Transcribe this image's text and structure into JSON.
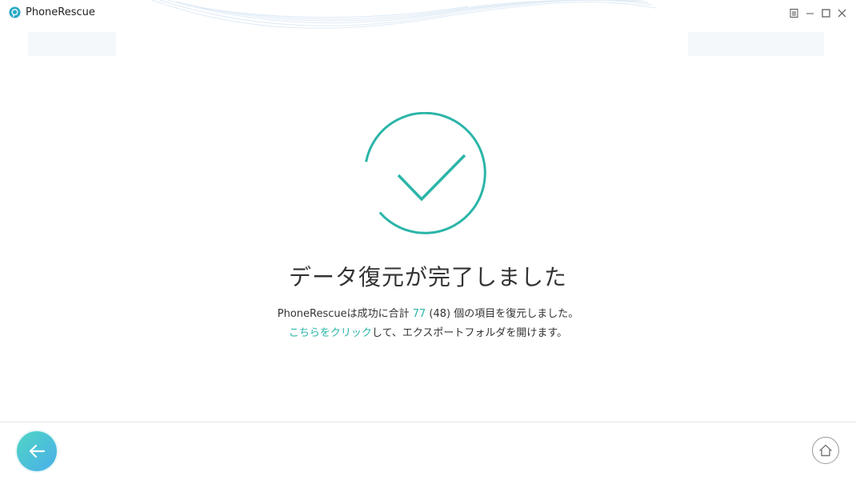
{
  "app": {
    "title": "PhoneRescue",
    "logo_icon": "phonerescue-logo-icon"
  },
  "window_controls": {
    "menu_icon": "menu-icon",
    "minimize_icon": "minimize-icon",
    "maximize_icon": "maximize-icon",
    "close_icon": "close-icon"
  },
  "result": {
    "title": "データ復元が完了しました",
    "summary_prefix": "PhoneRescueは成功に合計 ",
    "total_count": "77",
    "summary_middle": " (48) 個の項目を復元しました。",
    "link_text": "こちらをクリック",
    "link_suffix": "して、エクスポートフォルダを開けます。"
  },
  "footer": {
    "back_icon": "arrow-left-icon",
    "home_icon": "home-icon"
  },
  "colors": {
    "accent": "#2bb5a8",
    "back_gradient_start": "#4fd6c4",
    "back_gradient_end": "#4aaeea",
    "text": "#333333"
  }
}
